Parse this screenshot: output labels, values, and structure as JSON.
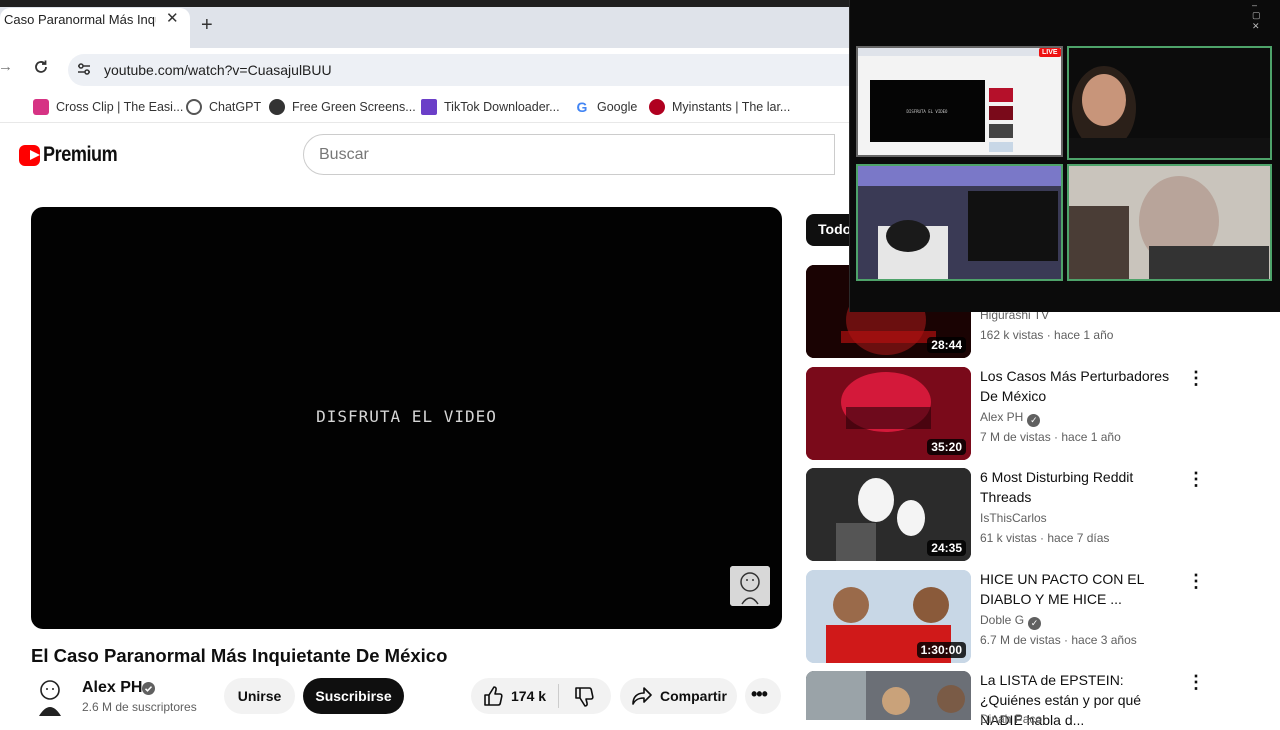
{
  "browser": {
    "tab": {
      "title": "Caso Paranormal Más Inquietante De México - YouTube",
      "close": "✕"
    },
    "new_tab": "+",
    "url": "youtube.com/watch?v=CuasajulBUU",
    "bookmarks": [
      {
        "label": "Cross Clip | The Easi...",
        "icon": "crossclip-icon",
        "color": "#d63384"
      },
      {
        "label": "ChatGPT",
        "icon": "chatgpt-icon",
        "color": "#444444"
      },
      {
        "label": "Free Green Screens...",
        "icon": "greenscreen-icon",
        "color": "#333333"
      },
      {
        "label": "TikTok Downloader...",
        "icon": "tiktok-download-icon",
        "color": "#6b3fc8"
      },
      {
        "label": "Google",
        "icon": "google-icon",
        "color": "#4285f4"
      },
      {
        "label": "Myinstants | The lar...",
        "icon": "myinstants-icon",
        "color": "#b00020"
      }
    ]
  },
  "youtube": {
    "brand": "Premium",
    "search_placeholder": "Buscar",
    "player_text": "DISFRUTA EL VIDEO",
    "video_title": "El Caso Paranormal Más Inquietante De México",
    "channel": {
      "name": "Alex PH",
      "subscribers": "2.6 M de suscriptores"
    },
    "join_label": "Unirse",
    "subscribe_label": "Suscribirse",
    "like_count": "174 k",
    "share_label": "Compartir",
    "more_label": "•••",
    "chip_all": "Todo"
  },
  "recommended": [
    {
      "title": "",
      "channel": "Higurashi TV",
      "meta": "162 k vistas · hace 1 año",
      "duration": "28:44",
      "verified": false,
      "thumb_color": "#2a0505"
    },
    {
      "title": "Los Casos Más Perturbadores De México",
      "channel": "Alex PH",
      "meta": "7 M de vistas · hace 1 año",
      "duration": "35:20",
      "verified": true,
      "thumb_color": "#b5102a"
    },
    {
      "title": "6 Most Disturbing Reddit Threads",
      "channel": "IsThisCarlos",
      "meta": "61 k vistas · hace 7 días",
      "duration": "24:35",
      "verified": false,
      "thumb_color": "#3a3a3a"
    },
    {
      "title": "HICE UN PACTO CON EL DIABLO Y ME HICE ...",
      "channel": "Doble G",
      "meta": "6.7 M de vistas · hace 3 años",
      "duration": "1:30:00",
      "verified": true,
      "thumb_color": "#c8d7e6"
    },
    {
      "title": "La LISTA de EPSTEIN: ¿Quiénes están y por qué NADIE habla d...",
      "channel": "Dinah Paco",
      "meta": "",
      "duration": "",
      "verified": false,
      "thumb_color": "#6b6f76"
    }
  ],
  "overlay": {
    "live_badge": "LIVE",
    "window_controls": "– ▢ ✕",
    "thumb_text": "DISFRUTA EL VIDEO",
    "accent": "#4ea36a"
  }
}
